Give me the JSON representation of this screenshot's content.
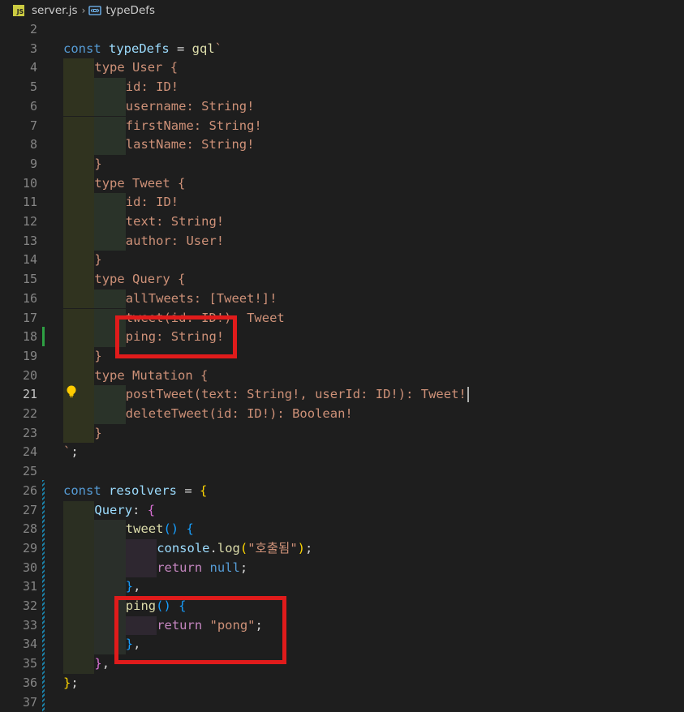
{
  "breadcrumb": {
    "file_icon_text": "JS",
    "file_name": "server.js",
    "separator": "›",
    "symbol_name": "typeDefs"
  },
  "editor": {
    "active_line": 21,
    "lines": [
      {
        "num": "2",
        "indent": 0,
        "tokens": []
      },
      {
        "num": "3",
        "indent": 0,
        "tokens": [
          [
            "kw",
            "const "
          ],
          [
            "id",
            "typeDefs"
          ],
          [
            "pl",
            " = "
          ],
          [
            "fn",
            "gql"
          ],
          [
            "str",
            "`"
          ]
        ]
      },
      {
        "num": "4",
        "indent": 1,
        "tokens": [
          [
            "ty",
            "type User {"
          ]
        ]
      },
      {
        "num": "5",
        "indent": 2,
        "tokens": [
          [
            "ty",
            "id: ID!"
          ]
        ]
      },
      {
        "num": "6",
        "indent": 2,
        "tokens": [
          [
            "ty",
            "username: String!"
          ]
        ]
      },
      {
        "num": "7",
        "indent": 2,
        "tokens": [
          [
            "ty",
            "firstName: String!"
          ]
        ]
      },
      {
        "num": "8",
        "indent": 2,
        "tokens": [
          [
            "ty",
            "lastName: String!"
          ]
        ]
      },
      {
        "num": "9",
        "indent": 1,
        "tokens": [
          [
            "ty",
            "}"
          ]
        ]
      },
      {
        "num": "10",
        "indent": 1,
        "tokens": [
          [
            "ty",
            "type Tweet {"
          ]
        ]
      },
      {
        "num": "11",
        "indent": 2,
        "tokens": [
          [
            "ty",
            "id: ID!"
          ]
        ]
      },
      {
        "num": "12",
        "indent": 2,
        "tokens": [
          [
            "ty",
            "text: String!"
          ]
        ]
      },
      {
        "num": "13",
        "indent": 2,
        "tokens": [
          [
            "ty",
            "author: User!"
          ]
        ]
      },
      {
        "num": "14",
        "indent": 1,
        "tokens": [
          [
            "ty",
            "}"
          ]
        ]
      },
      {
        "num": "15",
        "indent": 1,
        "tokens": [
          [
            "ty",
            "type Query {"
          ]
        ]
      },
      {
        "num": "16",
        "indent": 2,
        "tokens": [
          [
            "ty",
            "allTweets: [Tweet!]!"
          ]
        ]
      },
      {
        "num": "17",
        "indent": 2,
        "tokens": [
          [
            "ty",
            "tweet(id: ID!): Tweet"
          ]
        ]
      },
      {
        "num": "18",
        "indent": 2,
        "tokens": [
          [
            "ty",
            "ping: String!"
          ]
        ]
      },
      {
        "num": "19",
        "indent": 1,
        "tokens": [
          [
            "ty",
            "}"
          ]
        ]
      },
      {
        "num": "20",
        "indent": 1,
        "tokens": [
          [
            "ty",
            "type Mutation {"
          ]
        ]
      },
      {
        "num": "21",
        "indent": 2,
        "tokens": [
          [
            "ty",
            "postTweet(text: String!, userId: ID!): Tweet!"
          ]
        ]
      },
      {
        "num": "22",
        "indent": 2,
        "tokens": [
          [
            "ty",
            "deleteTweet(id: ID!): Boolean!"
          ]
        ]
      },
      {
        "num": "23",
        "indent": 1,
        "tokens": [
          [
            "ty",
            "}"
          ]
        ]
      },
      {
        "num": "24",
        "indent": 0,
        "tokens": [
          [
            "str",
            "`"
          ],
          [
            "pl",
            ";"
          ]
        ]
      },
      {
        "num": "25",
        "indent": 0,
        "tokens": []
      },
      {
        "num": "26",
        "indent": 0,
        "tokens": [
          [
            "kw",
            "const "
          ],
          [
            "id",
            "resolvers"
          ],
          [
            "pl",
            " = "
          ],
          [
            "br1",
            "{"
          ]
        ]
      },
      {
        "num": "27",
        "indent": 1,
        "tokens": [
          [
            "id",
            "Query"
          ],
          [
            "pl",
            ": "
          ],
          [
            "br2",
            "{"
          ]
        ]
      },
      {
        "num": "28",
        "indent": 2,
        "tokens": [
          [
            "fn",
            "tweet"
          ],
          [
            "br3",
            "()"
          ],
          [
            "pl",
            " "
          ],
          [
            "br3",
            "{"
          ]
        ]
      },
      {
        "num": "29",
        "indent": 3,
        "tokens": [
          [
            "id",
            "console"
          ],
          [
            "pl",
            "."
          ],
          [
            "fn",
            "log"
          ],
          [
            "br1",
            "("
          ],
          [
            "str",
            "\"호출됨\""
          ],
          [
            "br1",
            ")"
          ],
          [
            "pl",
            ";"
          ]
        ]
      },
      {
        "num": "30",
        "indent": 3,
        "tokens": [
          [
            "kw2",
            "return "
          ],
          [
            "kw",
            "null"
          ],
          [
            "pl",
            ";"
          ]
        ]
      },
      {
        "num": "31",
        "indent": 2,
        "tokens": [
          [
            "br3",
            "}"
          ],
          [
            "pl",
            ","
          ]
        ]
      },
      {
        "num": "32",
        "indent": 2,
        "tokens": [
          [
            "fn",
            "ping"
          ],
          [
            "br3",
            "()"
          ],
          [
            "pl",
            " "
          ],
          [
            "br3",
            "{"
          ]
        ]
      },
      {
        "num": "33",
        "indent": 3,
        "tokens": [
          [
            "kw2",
            "return "
          ],
          [
            "str",
            "\"pong\""
          ],
          [
            "pl",
            ";"
          ]
        ]
      },
      {
        "num": "34",
        "indent": 2,
        "tokens": [
          [
            "br3",
            "}"
          ],
          [
            "pl",
            ","
          ]
        ]
      },
      {
        "num": "35",
        "indent": 1,
        "tokens": [
          [
            "br2",
            "}"
          ],
          [
            "pl",
            ","
          ]
        ]
      },
      {
        "num": "36",
        "indent": 0,
        "tokens": [
          [
            "br1",
            "}"
          ],
          [
            "pl",
            ";"
          ]
        ]
      },
      {
        "num": "37",
        "indent": 0,
        "tokens": []
      }
    ]
  },
  "colors": {
    "background": "#1e1e1e",
    "highlight_box": "#e01b1b",
    "modified_line": "#2ea043"
  }
}
